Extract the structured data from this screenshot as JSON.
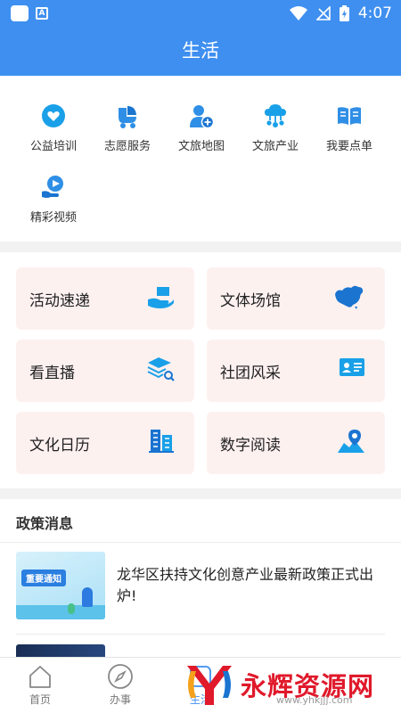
{
  "status_bar": {
    "time": "4:07"
  },
  "header": {
    "title": "生活"
  },
  "services": [
    {
      "label": "公益培训",
      "icon": "heart-hand-icon"
    },
    {
      "label": "志愿服务",
      "icon": "stroller-icon"
    },
    {
      "label": "文旅地图",
      "icon": "user-plus-icon"
    },
    {
      "label": "文旅产业",
      "icon": "cloud-network-icon"
    },
    {
      "label": "我要点单",
      "icon": "open-book-icon"
    },
    {
      "label": "精彩视频",
      "icon": "play-hand-icon"
    }
  ],
  "tiles": [
    {
      "label": "活动速递",
      "icon": "delivery-hand-icon"
    },
    {
      "label": "文体场馆",
      "icon": "china-map-icon"
    },
    {
      "label": "看直播",
      "icon": "book-stack-search-icon"
    },
    {
      "label": "社团风采",
      "icon": "id-card-icon"
    },
    {
      "label": "文化日历",
      "icon": "buildings-icon"
    },
    {
      "label": "数字阅读",
      "icon": "map-pin-icon"
    }
  ],
  "policy": {
    "title": "政策消息",
    "items": [
      {
        "title": "龙华区扶持文化创意产业最新政策正式出炉!",
        "thumb_text": "重要通知"
      }
    ]
  },
  "tabbar": {
    "tabs": [
      {
        "label": "首页",
        "icon": "home-icon"
      },
      {
        "label": "办事",
        "icon": "compass-icon"
      },
      {
        "label": "生活",
        "icon": "life-icon"
      }
    ]
  },
  "watermark": {
    "text": "永辉资源网",
    "url": "www.yhkjjj.com"
  },
  "colors": {
    "primary": "#3e8ff0",
    "tile_bg": "#fdf1f0",
    "watermark": "#e0192b"
  }
}
